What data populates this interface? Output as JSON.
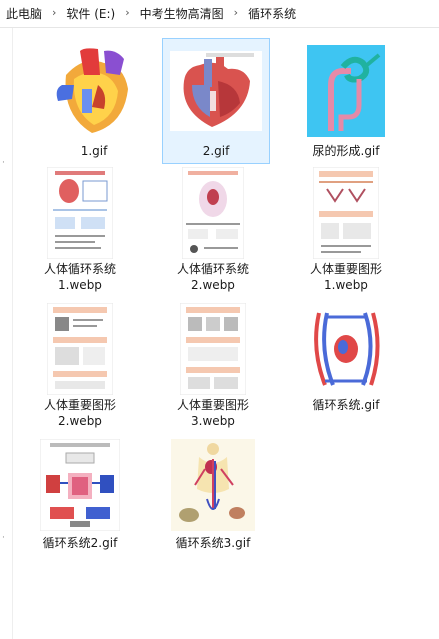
{
  "breadcrumb": {
    "items": [
      "此电脑",
      "软件 (E:)",
      "中考生物高清图",
      "循环系统"
    ],
    "separator": "›"
  },
  "files": [
    {
      "name": "1.gif",
      "thumb": "heart-cutaway",
      "selected": false
    },
    {
      "name": "2.gif",
      "thumb": "heart-diagram",
      "selected": true
    },
    {
      "name": "尿的形成.gif",
      "thumb": "nephron",
      "selected": false
    },
    {
      "name": "人体循环系统\n1.webp",
      "thumb": "worksheet",
      "selected": false
    },
    {
      "name": "人体循环系统\n2.webp",
      "thumb": "worksheet",
      "selected": false
    },
    {
      "name": "人体重要图形\n1.webp",
      "thumb": "worksheet",
      "selected": false
    },
    {
      "name": "人体重要图形\n2.webp",
      "thumb": "worksheet",
      "selected": false
    },
    {
      "name": "人体重要图形\n3.webp",
      "thumb": "worksheet",
      "selected": false
    },
    {
      "name": "循环系统.gif",
      "thumb": "circulation-chart",
      "selected": false
    },
    {
      "name": "循环系统2.gif",
      "thumb": "circulation-flow",
      "selected": false
    },
    {
      "name": "循环系统3.gif",
      "thumb": "circulation-body",
      "selected": false
    }
  ]
}
